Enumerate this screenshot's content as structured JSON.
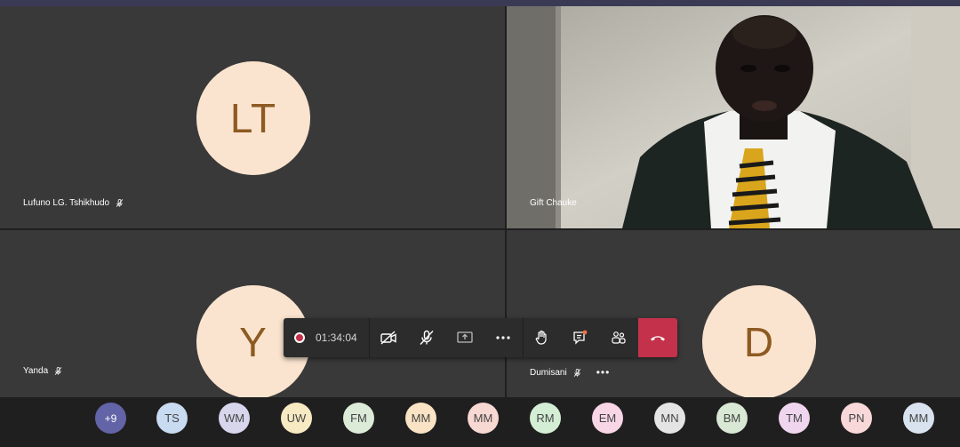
{
  "participants_grid": [
    {
      "name": "Lufuno LG. Tshikhudo",
      "initials": "LT",
      "muted": true
    },
    {
      "name": "Gift Chauke",
      "has_video": true
    },
    {
      "name": "Yanda",
      "initials": "Y",
      "muted": true
    },
    {
      "name": "Dumisani",
      "initials": "D",
      "muted": true,
      "more": "•••"
    }
  ],
  "toolbar": {
    "recording_icon": "record-dot",
    "timer": "01:34:04",
    "buttons": [
      "camera-off-icon",
      "mic-off-icon",
      "share-screen-icon",
      "more-icon",
      "raise-hand-icon",
      "chat-icon",
      "participants-icon",
      "hang-up-icon"
    ],
    "hangup_color": "#c4314b"
  },
  "roster": [
    {
      "label": "+9",
      "color": "#6264a7"
    },
    {
      "label": "TS",
      "color": "#c9dbf0"
    },
    {
      "label": "WM",
      "color": "#d7d6ec"
    },
    {
      "label": "UW",
      "color": "#f7eac2"
    },
    {
      "label": "FM",
      "color": "#dcebd8"
    },
    {
      "label": "MM",
      "color": "#f9e3c4"
    },
    {
      "label": "MM",
      "color": "#f8d8d2"
    },
    {
      "label": "RM",
      "color": "#d3eed5"
    },
    {
      "label": "EM",
      "color": "#f8d6e6"
    },
    {
      "label": "MN",
      "color": "#e4e4e4"
    },
    {
      "label": "BM",
      "color": "#d8e8d4"
    },
    {
      "label": "TM",
      "color": "#efd6ee"
    },
    {
      "label": "PN",
      "color": "#f8d8d8"
    },
    {
      "label": "MM",
      "color": "#d9e3ef"
    }
  ]
}
